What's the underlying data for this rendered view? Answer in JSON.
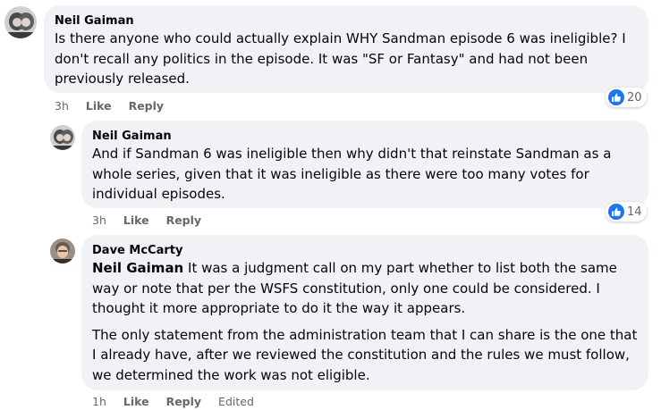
{
  "comments": [
    {
      "author": "Neil Gaiman",
      "text": "Is there anyone who could actually explain WHY Sandman episode 6 was ineligible? I don't recall any politics in the episode. It was \"SF or Fantasy\" and had not been previously released.",
      "time": "3h",
      "like_label": "Like",
      "reply_label": "Reply",
      "reaction_count": "20",
      "reaction_icon": "like-icon"
    },
    {
      "author": "Neil Gaiman",
      "text": "And if Sandman 6 was ineligible then why didn't that reinstate Sandman as a whole series, given that it was ineligible as there were too many votes for individual episodes.",
      "time": "3h",
      "like_label": "Like",
      "reply_label": "Reply",
      "reaction_count": "14",
      "reaction_icon": "like-icon"
    },
    {
      "author": "Dave McCarty",
      "mention": "Neil Gaiman",
      "text_p1": " It was a judgment call on my part whether to list both the same way or note that per the WSFS constitution, only one could be considered. I thought it more appropriate to do it the way it appears.",
      "text_p2": "The only statement from the administration team that I can share is the one that I already have, after we reviewed the constitution and the rules we must follow, we determined the work was not eligible.",
      "time": "1h",
      "like_label": "Like",
      "reply_label": "Reply",
      "edited_label": "Edited"
    }
  ],
  "colors": {
    "bubble": "#f0f2f5",
    "secondary_text": "#65676b",
    "like_blue": "#1877f2"
  }
}
